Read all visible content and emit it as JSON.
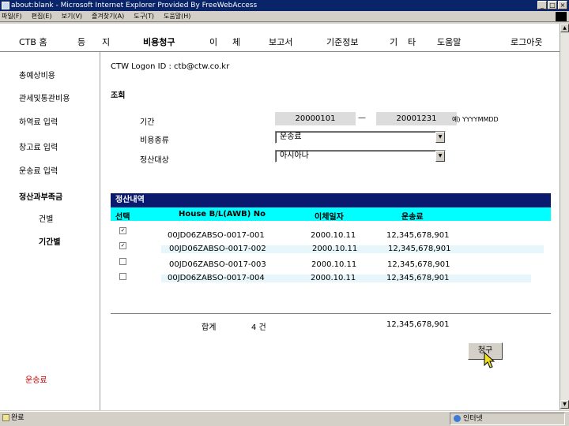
{
  "window": {
    "title": "about:blank - Microsoft Internet Explorer Provided By FreeWebAccess",
    "controls": [
      "_",
      "□",
      "×"
    ]
  },
  "menubar": {
    "items": [
      "파일(F)",
      "편집(E)",
      "보기(V)",
      "즐겨찾기(A)",
      "도구(T)",
      "도움말(H)"
    ]
  },
  "topnav": {
    "brand": "CTB 홈",
    "items": [
      "등",
      "지",
      "비용청구",
      "이",
      "체",
      "보고서",
      "기준정보",
      "기",
      "타",
      "도움말",
      "로그아웃"
    ]
  },
  "sidebar": {
    "items": [
      "총예상비용",
      "관세및통관비용",
      "하역료 입력",
      "창고료 입력",
      "운송료 입력",
      "정산과부족금",
      "건별",
      "기간별"
    ],
    "footer": "운송료"
  },
  "main": {
    "logon": "CTW Logon ID : ctb@ctw.co.kr",
    "search_heading": "조회",
    "period_label": "기간",
    "date_from": "20000101",
    "date_dash": "—",
    "date_to": "20001231",
    "date_hint": "예) YYYYMMDD",
    "cost_type_label": "비용종류",
    "cost_type_value": "운송료",
    "settle_target_label": "정산대상",
    "settle_target_value": "아시아나"
  },
  "table": {
    "title": "정산내역",
    "headers": {
      "select": "선택",
      "house_bl": "House B/L(AWB) No",
      "transfer_date": "이체일자",
      "fee": "운송료"
    },
    "rows": [
      {
        "checked": true,
        "house_bl": "00JD06ZABSO-0017-001",
        "date": "2000.10.11",
        "amount": "12,345,678,901"
      },
      {
        "checked": true,
        "house_bl": "00JD06ZABSO-0017-002",
        "date": "2000.10.11",
        "amount": "12,345,678,901"
      },
      {
        "checked": false,
        "house_bl": "00JD06ZABSO-0017-003",
        "date": "2000.10.11",
        "amount": "12,345,678,901"
      },
      {
        "checked": false,
        "house_bl": "00JD06ZABSO-0017-004",
        "date": "2000.10.11",
        "amount": "12,345,678,901"
      }
    ],
    "total_label": "합계",
    "total_count": "4 건",
    "total_amount": "12,345,678,901"
  },
  "claim_button": "청구",
  "status": {
    "left": "완료",
    "zone": "인터넷"
  }
}
